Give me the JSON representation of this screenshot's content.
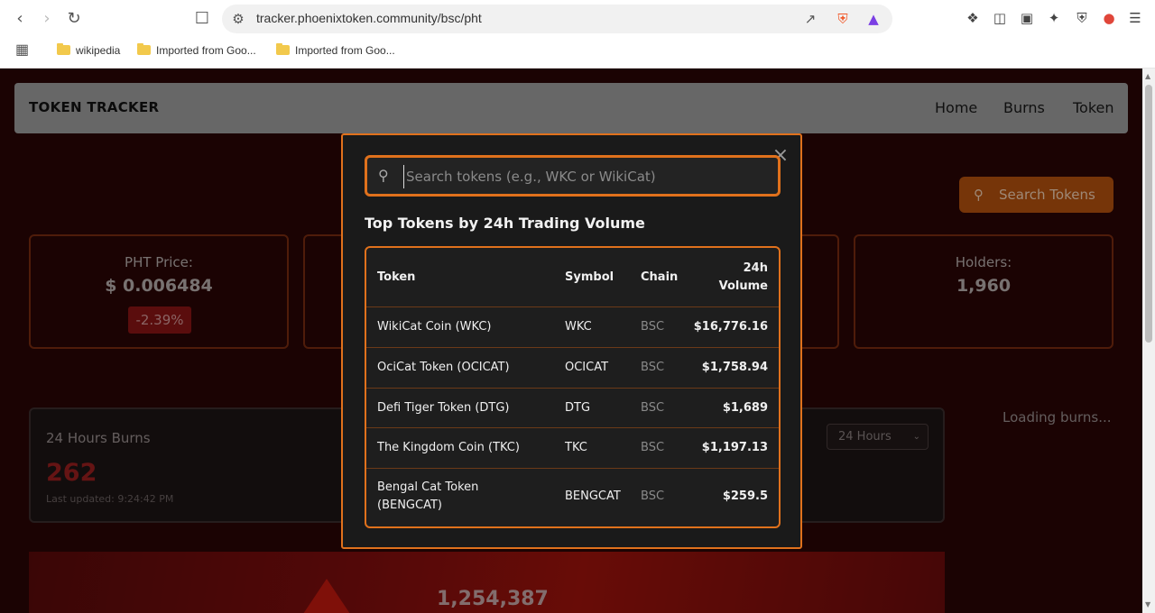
{
  "browser": {
    "url": "tracker.phoenixtoken.community/bsc/pht",
    "bookmarks": [
      "wikipedia",
      "Imported from Goo...",
      "Imported from Goo..."
    ]
  },
  "site": {
    "brand": "TOKEN TRACKER",
    "nav": [
      "Home",
      "Burns",
      "Token"
    ],
    "search_button": "Search Tokens"
  },
  "stats": {
    "price_label": "PHT Price:",
    "price_value": "$ 0.006484",
    "price_change": "-2.39%",
    "holders_label": "Holders:",
    "holders_value": "1,960"
  },
  "burns": {
    "title": "24 Hours Burns",
    "value": "262",
    "updated": "Last updated: 9:24:42 PM",
    "period": "24 Hours",
    "loading": "Loading burns...",
    "banner_value": "1,254,387"
  },
  "modal": {
    "search_placeholder": "Search tokens (e.g., WKC or WikiCat)",
    "title": "Top Tokens by 24h Trading Volume",
    "columns": {
      "token": "Token",
      "symbol": "Symbol",
      "chain": "Chain",
      "volume_line1": "24h",
      "volume_line2": "Volume"
    },
    "rows": [
      {
        "token": "WikiCat Coin (WKC)",
        "symbol": "WKC",
        "chain": "BSC",
        "volume": "$16,776.16"
      },
      {
        "token": "OciCat Token (OCICAT)",
        "symbol": "OCICAT",
        "chain": "BSC",
        "volume": "$1,758.94"
      },
      {
        "token": "Defi Tiger Token (DTG)",
        "symbol": "DTG",
        "chain": "BSC",
        "volume": "$1,689"
      },
      {
        "token": "The Kingdom Coin (TKC)",
        "symbol": "TKC",
        "chain": "BSC",
        "volume": "$1,197.13"
      },
      {
        "token_line1": "Bengal Cat Token",
        "token_line2": "(BENGCAT)",
        "symbol": "BENGCAT",
        "chain": "BSC",
        "volume": "$259.5"
      }
    ]
  }
}
